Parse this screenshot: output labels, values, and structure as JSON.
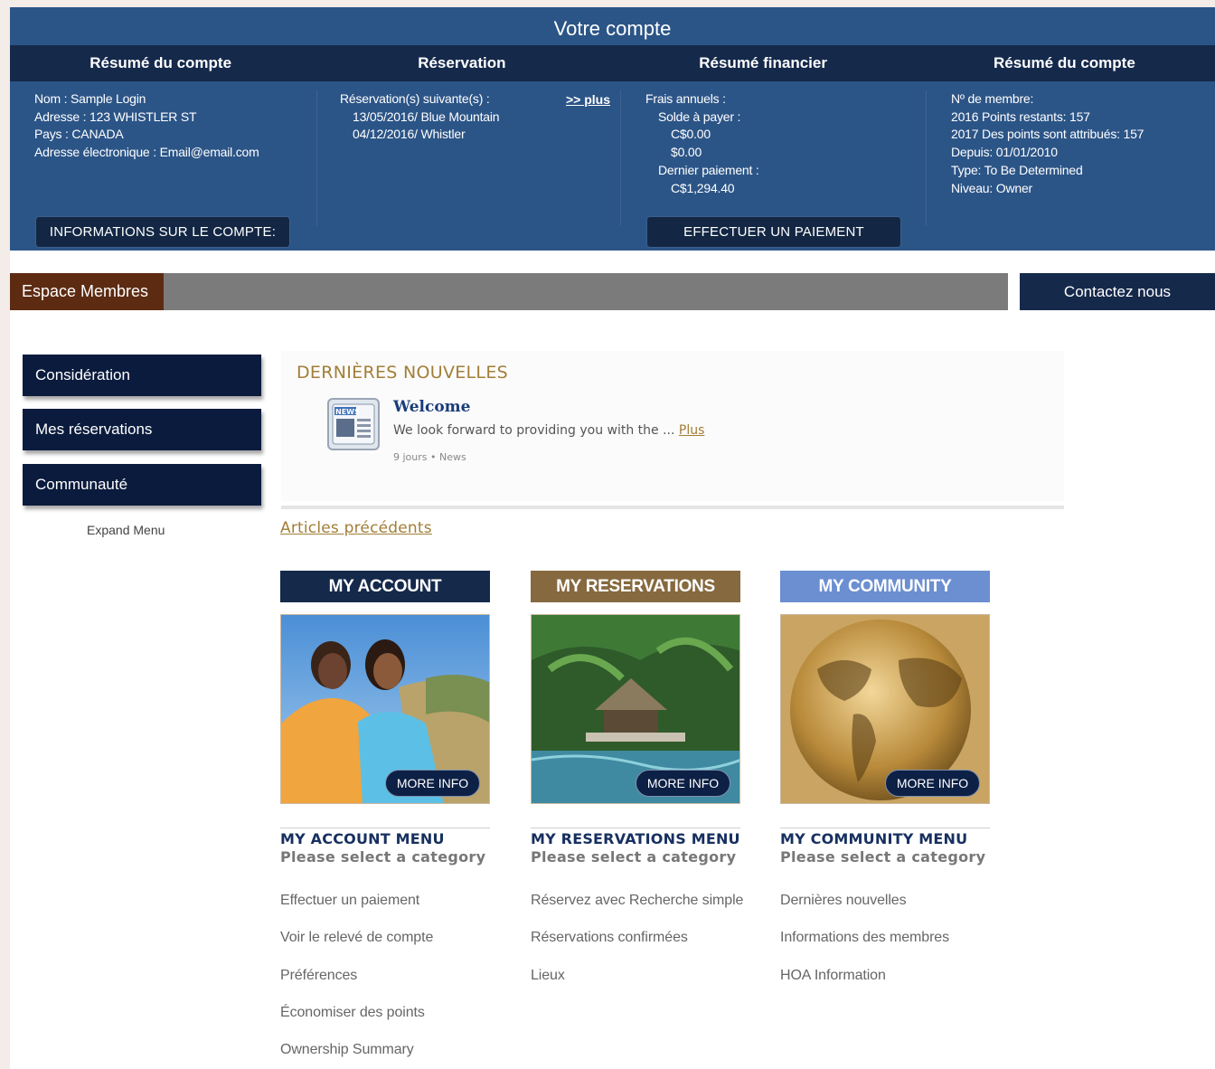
{
  "header": {
    "title": "Votre compte",
    "columns": [
      "Résumé du compte",
      "Réservation",
      "Résumé financier",
      "Résumé du compte"
    ]
  },
  "account": {
    "name": "Nom : Sample Login",
    "address": "Adresse : 123 WHISTLER ST",
    "country": "Pays : CANADA",
    "email": "Adresse électronique : Email@email.com",
    "info_button": "INFORMATIONS SUR LE COMPTE:"
  },
  "reservation": {
    "label": "Réservation(s) suivante(s) :",
    "items": [
      "13/05/2016/ Blue Mountain",
      "04/12/2016/ Whistler"
    ],
    "more_link": ">> plus"
  },
  "financial": {
    "annual_fees": "Frais annuels :",
    "balance_label": "Solde à payer :",
    "balance_cad": "C$0.00",
    "balance_usd": "$0.00",
    "last_payment_label": "Dernier paiement :",
    "last_payment_value": "C$1,294.40",
    "pay_button": "EFFECTUER UN PAIEMENT"
  },
  "membership": {
    "member_no": "Nº de membre:",
    "points_2016": "2016 Points restants: 157",
    "points_2017": "2017 Des points sont attribués: 157",
    "since": "Depuis: 01/01/2010",
    "type": "Type: To Be Determined",
    "level": "Niveau: Owner"
  },
  "members_bar": {
    "label": "Espace Membres",
    "contact": "Contactez nous"
  },
  "sidebar": {
    "items": [
      "Considération",
      "Mes réservations",
      "Communauté"
    ],
    "expand": "Expand Menu"
  },
  "news": {
    "heading": "DERNIÈRES NOUVELLES",
    "icon_label": "NEWS",
    "title": "Welcome",
    "excerpt": "We look forward to providing you with the ...",
    "more": "Plus",
    "meta": "9 jours • News",
    "previous": "Articles précédents"
  },
  "cards": [
    {
      "title": "MY ACCOUNT",
      "color": "#15294b",
      "more": "MORE INFO",
      "menu_title": "MY ACCOUNT MENU",
      "menu_sub": "Please select a category",
      "links": [
        "Effectuer un paiement",
        "Voir le relevé de compte",
        "Préférences",
        "Économiser des points",
        "Ownership Summary"
      ]
    },
    {
      "title": "MY RESERVATIONS",
      "color": "#86693f",
      "more": "MORE INFO",
      "menu_title": "MY RESERVATIONS MENU",
      "menu_sub": "Please select a category",
      "links": [
        "Réservez avec Recherche simple",
        "Réservations confirmées",
        "Lieux"
      ]
    },
    {
      "title": "MY COMMUNITY",
      "color": "#6b8fd1",
      "more": "MORE INFO",
      "menu_title": "MY COMMUNITY MENU",
      "menu_sub": "Please select a category",
      "links": [
        "Dernières nouvelles",
        "Informations des membres",
        "HOA Information"
      ]
    }
  ]
}
